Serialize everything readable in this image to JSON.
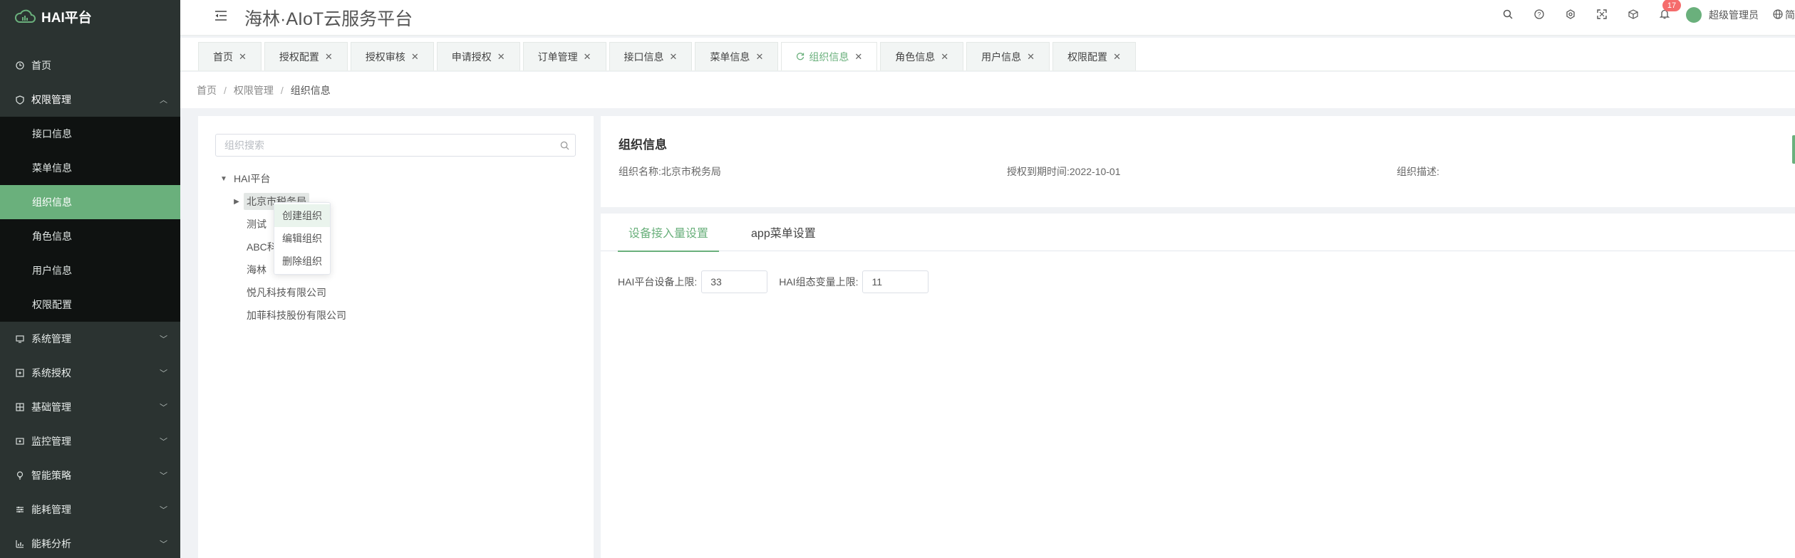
{
  "app": {
    "title": "HAI平台",
    "platform_title": "海林·AIoT云服务平台"
  },
  "sidebar": {
    "items": [
      {
        "label": "首页",
        "icon": "clock-icon"
      },
      {
        "label": "权限管理",
        "icon": "shield-icon",
        "open": true,
        "children": [
          {
            "label": "接口信息"
          },
          {
            "label": "菜单信息"
          },
          {
            "label": "组织信息",
            "active": true
          },
          {
            "label": "角色信息"
          },
          {
            "label": "用户信息"
          },
          {
            "label": "权限配置"
          }
        ]
      },
      {
        "label": "系统管理",
        "icon": "monitor-icon"
      },
      {
        "label": "系统授权",
        "icon": "key-icon"
      },
      {
        "label": "基础管理",
        "icon": "grid-icon"
      },
      {
        "label": "监控管理",
        "icon": "video-icon"
      },
      {
        "label": "智能策略",
        "icon": "bulb-icon"
      },
      {
        "label": "能耗管理",
        "icon": "sliders-icon"
      },
      {
        "label": "能耗分析",
        "icon": "chart-icon"
      }
    ]
  },
  "header": {
    "notification_count": "17",
    "user_name": "超级管理员",
    "language": "简"
  },
  "tabs": [
    {
      "label": "首页"
    },
    {
      "label": "授权配置"
    },
    {
      "label": "授权审核"
    },
    {
      "label": "申请授权"
    },
    {
      "label": "订单管理"
    },
    {
      "label": "接口信息"
    },
    {
      "label": "菜单信息"
    },
    {
      "label": "组织信息",
      "active": true
    },
    {
      "label": "角色信息"
    },
    {
      "label": "用户信息"
    },
    {
      "label": "权限配置"
    }
  ],
  "breadcrumb": {
    "items": [
      "首页",
      "权限管理",
      "组织信息"
    ],
    "separator": "/"
  },
  "org_tree": {
    "search_placeholder": "组织搜索",
    "root": "HAI平台",
    "children": [
      "北京市税务局",
      "测试",
      "ABC",
      "海林",
      "悦凡科技有限公司",
      "加菲科技股份有限公司"
    ],
    "visible_labels": {
      "beijing": "北京市税务局",
      "test": "测试",
      "abc": "ABC科",
      "hailin": "海林"
    }
  },
  "context_menu": {
    "items": [
      "创建组织",
      "编辑组织",
      "删除组织"
    ]
  },
  "org_info": {
    "heading": "组织信息",
    "name_label": "组织名称:",
    "name_value": "北京市税务局",
    "expire_label": "授权到期时间:",
    "expire_value": "2022-10-01",
    "desc_label": "组织描述:",
    "desc_value": ""
  },
  "settings": {
    "tabs": [
      "设备接入量设置",
      "app菜单设置"
    ],
    "active_tab": 0,
    "fields": [
      {
        "label": "HAI平台设备上限:",
        "value": "33"
      },
      {
        "label": "HAI组态变量上限:",
        "value": "11"
      }
    ]
  },
  "colors": {
    "accent": "#6ab07c",
    "sidebar_bg": "#2b3331",
    "submenu_bg": "#0f1211",
    "badge": "#f56c6c"
  }
}
